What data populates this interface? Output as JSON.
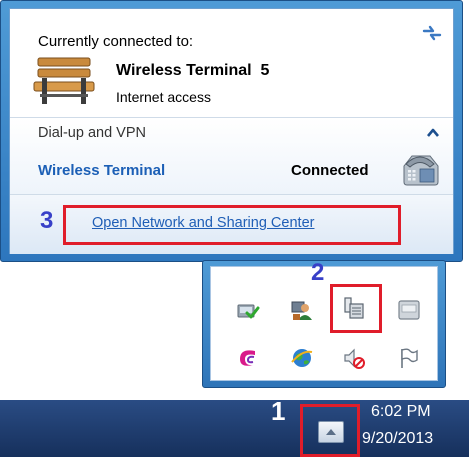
{
  "flyout": {
    "connected_title": "Currently connected to:",
    "connection": {
      "name": "Wireless Terminal  5",
      "status": "Internet access",
      "icon": "bench-network-icon"
    },
    "dialup": {
      "section_label": "Dial-up and VPN",
      "item_name": "Wireless Terminal",
      "item_status": "Connected",
      "icon": "phone-icon"
    },
    "footer": {
      "link_label": "Open Network and Sharing Center"
    }
  },
  "annotations": {
    "step1": "1",
    "step2": "2",
    "step3": "3"
  },
  "tray": {
    "icons": [
      "security-check-icon",
      "network-user-icon",
      "network-connection-icon",
      "device-icon",
      "swirl-app-icon",
      "globe-app-icon",
      "speaker-muted-icon",
      "action-center-flag-icon"
    ]
  },
  "taskbar": {
    "time": "6:02 PM",
    "date": "9/20/2013"
  },
  "colors": {
    "link": "#1f5eb6",
    "annotation_border": "#e01d2a",
    "annotation_number": "#3840c8",
    "taskbar": "#1e3c6e"
  }
}
